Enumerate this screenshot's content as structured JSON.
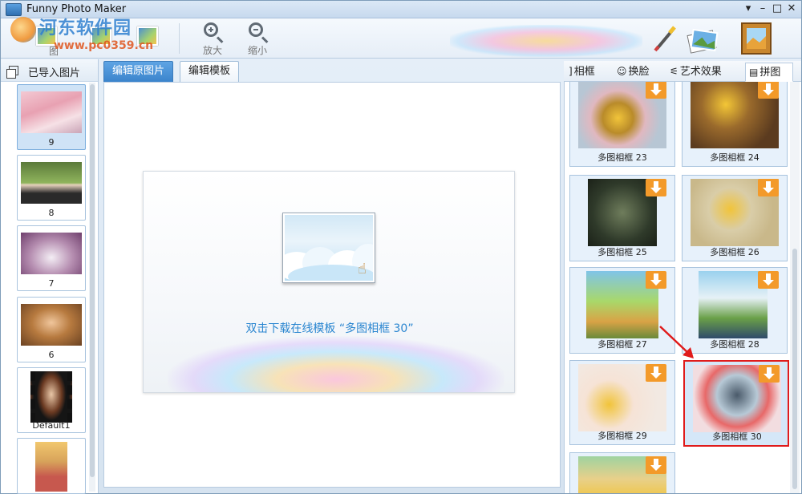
{
  "window": {
    "title": "Funny Photo Maker",
    "controls": [
      "▾",
      "–",
      "□",
      "✕"
    ]
  },
  "watermark": {
    "line1": "河东软件园",
    "line2": "www.pc0359.cn"
  },
  "toolbar": {
    "buttons": [
      {
        "label": "图",
        "icon": "photo-icon"
      },
      {
        "label": "",
        "icon": "photo-edit-icon"
      },
      {
        "label": "",
        "icon": "photo-save-icon"
      },
      {
        "label": "放大",
        "icon": "zoom-in-icon"
      },
      {
        "label": "缩小",
        "icon": "zoom-out-icon"
      }
    ],
    "deco_icons": [
      "brush-icon",
      "photo-stack-icon",
      "framed-picture-icon"
    ]
  },
  "left_panel": {
    "title": "已导入图片",
    "thumbnails": [
      {
        "caption": "9",
        "selected": true
      },
      {
        "caption": "8",
        "selected": false
      },
      {
        "caption": "7",
        "selected": false
      },
      {
        "caption": "6",
        "selected": false
      },
      {
        "caption": "Default1",
        "selected": false
      },
      {
        "caption": "",
        "selected": false
      }
    ]
  },
  "center": {
    "tabs": [
      {
        "label": "编辑原图片",
        "active": true
      },
      {
        "label": "编辑模板",
        "active": false
      }
    ],
    "message": "双击下载在线模板 “多图相框 30”"
  },
  "right_panel": {
    "tabs": [
      {
        "label": "相框",
        "icon": "frame-icon"
      },
      {
        "label": "换脸",
        "icon": "smiley-icon"
      },
      {
        "label": "艺术效果",
        "icon": "wand-icon"
      },
      {
        "label": "拼图",
        "icon": "collage-icon",
        "active": true
      }
    ],
    "frames": [
      {
        "caption": "多图相框 23"
      },
      {
        "caption": "多图相框 24"
      },
      {
        "caption": "多图相框 25"
      },
      {
        "caption": "多图相框 26"
      },
      {
        "caption": "多图相框 27"
      },
      {
        "caption": "多图相框 28"
      },
      {
        "caption": "多图相框 29"
      },
      {
        "caption": "多图相框 30",
        "selected": true
      },
      {
        "caption": ""
      }
    ]
  },
  "colors": {
    "accent": "#3b84cc",
    "highlight": "#e01b1b",
    "download": "#f39a2a",
    "message": "#2a86d0"
  }
}
